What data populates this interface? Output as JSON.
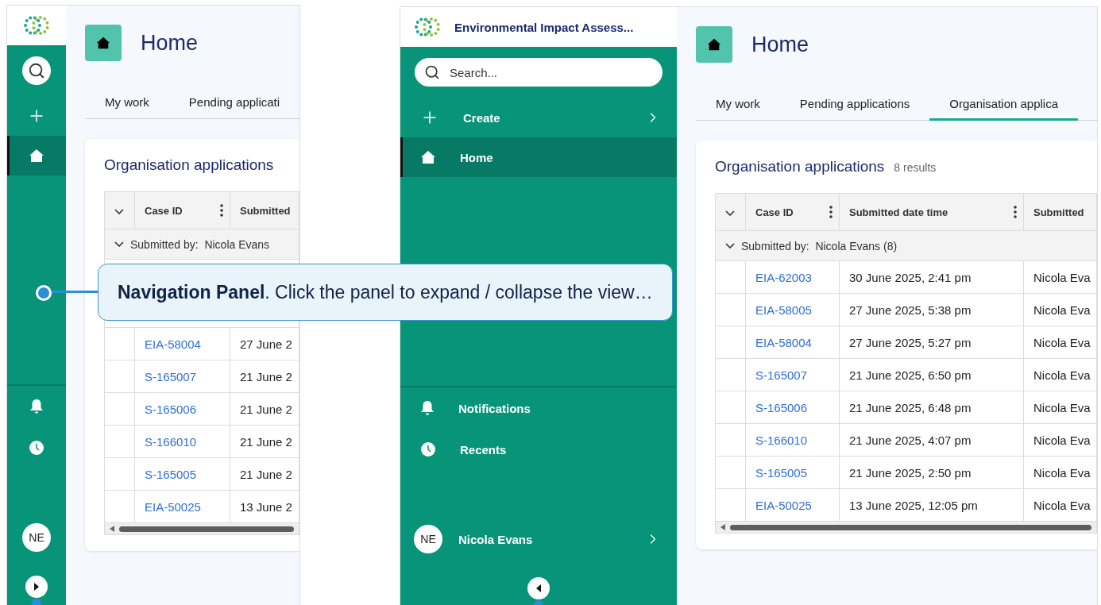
{
  "screens": [
    {
      "kind": "collapsed",
      "sidebar": {
        "nav": [
          {
            "kind": "create",
            "selected": false
          },
          {
            "kind": "home",
            "selected": true
          }
        ],
        "footer": [
          {
            "kind": "notifications"
          },
          {
            "kind": "recents"
          }
        ],
        "user": {
          "initials": "NE"
        }
      },
      "page": {
        "title": "Home",
        "tabs": [
          {
            "label": "My work",
            "selected": false
          },
          {
            "label": "Pending applicati",
            "selected": false
          }
        ],
        "card": {
          "title": "Organisation applications",
          "columns": [
            {
              "label": "Case ID",
              "menu": true
            },
            {
              "label": "Submitted",
              "menu": false
            }
          ],
          "group": "Submitted by:  Nicola Evans",
          "rows": [
            {
              "case_id": "EIA-58004",
              "submitted": "27 June 2"
            },
            {
              "case_id": "S-165007",
              "submitted": "21 June 2"
            },
            {
              "case_id": "S-165006",
              "submitted": "21 June 2"
            },
            {
              "case_id": "S-166010",
              "submitted": "21 June 2"
            },
            {
              "case_id": "S-165005",
              "submitted": "21 June 2"
            },
            {
              "case_id": "EIA-50025",
              "submitted": "13 June 2"
            }
          ]
        }
      }
    },
    {
      "kind": "expanded",
      "sidebar": {
        "title": "Environmental Impact Assess...",
        "search": {
          "placeholder": "Search..."
        },
        "nav": [
          {
            "kind": "create",
            "label": "Create",
            "selected": false,
            "submenu": true
          },
          {
            "kind": "home",
            "label": "Home",
            "selected": true,
            "submenu": false
          }
        ],
        "footer": [
          {
            "kind": "notifications",
            "label": "Notifications"
          },
          {
            "kind": "recents",
            "label": "Recents"
          }
        ],
        "user": {
          "initials": "NE",
          "name": "Nicola Evans",
          "submenu": true
        }
      },
      "page": {
        "title": "Home",
        "tabs": [
          {
            "label": "My work",
            "selected": false
          },
          {
            "label": "Pending applications",
            "selected": false
          },
          {
            "label": "Organisation applica",
            "selected": true
          }
        ],
        "card": {
          "title": "Organisation applications",
          "count": "8 results",
          "columns": [
            {
              "label": "Case ID",
              "menu": true
            },
            {
              "label": "Submitted date time",
              "menu": true
            },
            {
              "label": "Submitted",
              "menu": false
            }
          ],
          "group": "Submitted by:  Nicola Evans (8)",
          "rows": [
            {
              "case_id": "EIA-62003",
              "submitted": "30 June 2025, 2:41 pm",
              "by": "Nicola Eva"
            },
            {
              "case_id": "EIA-58005",
              "submitted": "27 June 2025, 5:38 pm",
              "by": "Nicola Eva"
            },
            {
              "case_id": "EIA-58004",
              "submitted": "27 June 2025, 5:27 pm",
              "by": "Nicola Eva"
            },
            {
              "case_id": "S-165007",
              "submitted": "21 June 2025, 6:50 pm",
              "by": "Nicola Eva"
            },
            {
              "case_id": "S-165006",
              "submitted": "21 June 2025, 6:48 pm",
              "by": "Nicola Eva"
            },
            {
              "case_id": "S-166010",
              "submitted": "21 June 2025, 4:07 pm",
              "by": "Nicola Eva"
            },
            {
              "case_id": "S-165005",
              "submitted": "21 June 2025, 2:50 pm",
              "by": "Nicola Eva"
            },
            {
              "case_id": "EIA-50025",
              "submitted": "13 June 2025, 12:05 pm",
              "by": "Nicola Eva"
            }
          ]
        }
      }
    }
  ],
  "callout": {
    "text": "**Navigation Panel**. Click the panel to expand / collapse the view…"
  }
}
